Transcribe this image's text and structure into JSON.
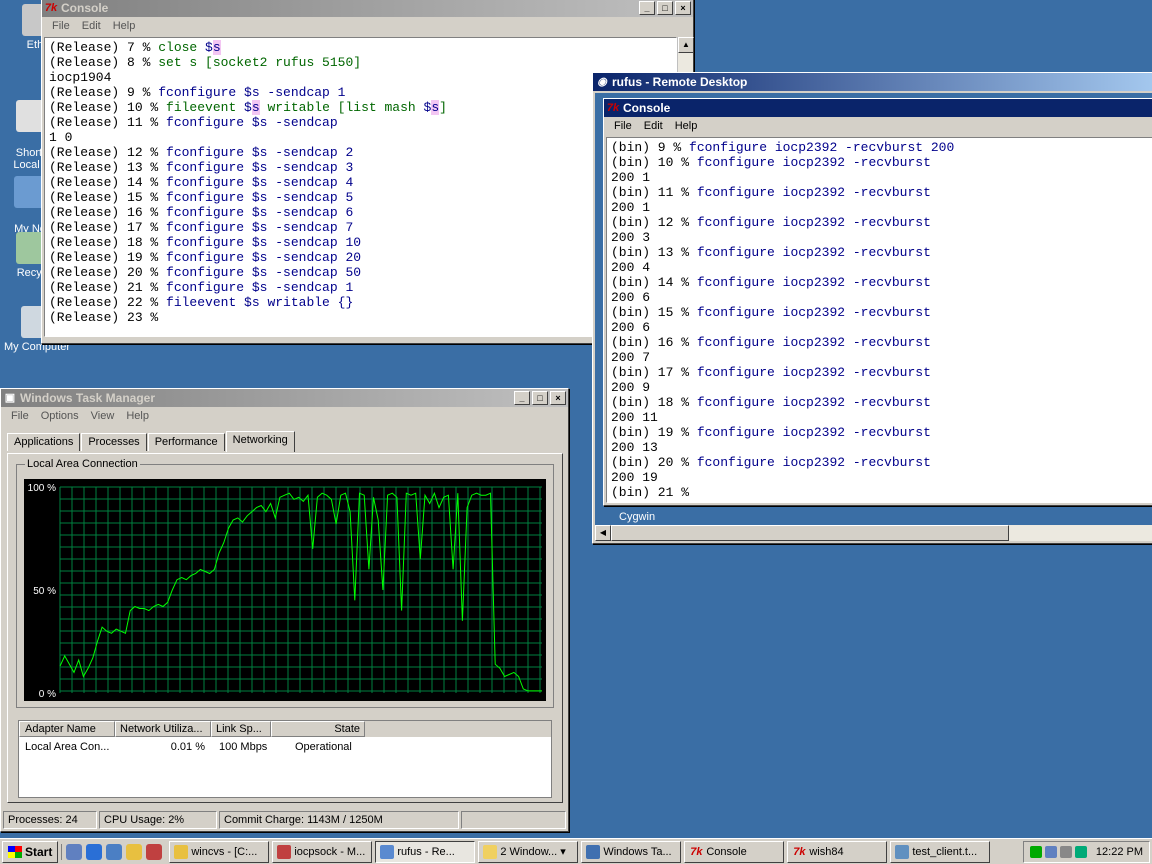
{
  "desktop": {
    "icons": [
      {
        "label": "Ethe",
        "top": 4
      },
      {
        "label": "Shorte\nLocal D",
        "top": 88
      },
      {
        "label": "My Ne\nPlac",
        "top": 164
      },
      {
        "label": "Recyc",
        "top": 236
      },
      {
        "label": "My Computer",
        "top": 310
      }
    ]
  },
  "console1": {
    "title": "Console",
    "menu": [
      "File",
      "Edit",
      "Help"
    ],
    "lines": [
      [
        [
          "(Release) 7 % ",
          ""
        ],
        [
          "close ",
          "cmd"
        ],
        [
          "$",
          "cmdb"
        ],
        [
          "s",
          "var cmdb"
        ]
      ],
      [
        [
          "(Release) 8 % ",
          ""
        ],
        [
          "set s [socket2 rufus 5150]",
          "cmd"
        ]
      ],
      [
        [
          "iocp1904",
          ""
        ]
      ],
      [
        [
          "(Release) 9 % ",
          ""
        ],
        [
          "fconfigure $s -sendcap 1",
          "cmdb"
        ]
      ],
      [
        [
          "(Release) 10 % ",
          ""
        ],
        [
          "fileevent ",
          "cmd"
        ],
        [
          "$",
          "cmdb"
        ],
        [
          "s",
          "var cmdb"
        ],
        [
          " writable [list mash ",
          "cmd"
        ],
        [
          "$",
          "cmdb"
        ],
        [
          "s",
          "var cmdb"
        ],
        [
          "]",
          "cmd"
        ]
      ],
      [
        [
          "(Release) 11 % ",
          ""
        ],
        [
          "fconfigure $s -sendcap",
          "cmdb"
        ]
      ],
      [
        [
          "1 0",
          ""
        ]
      ],
      [
        [
          "(Release) 12 % ",
          ""
        ],
        [
          "fconfigure $s -sendcap 2",
          "cmdb"
        ]
      ],
      [
        [
          "(Release) 13 % ",
          ""
        ],
        [
          "fconfigure $s -sendcap 3",
          "cmdb"
        ]
      ],
      [
        [
          "(Release) 14 % ",
          ""
        ],
        [
          "fconfigure $s -sendcap 4",
          "cmdb"
        ]
      ],
      [
        [
          "(Release) 15 % ",
          ""
        ],
        [
          "fconfigure $s -sendcap 5",
          "cmdb"
        ]
      ],
      [
        [
          "(Release) 16 % ",
          ""
        ],
        [
          "fconfigure $s -sendcap 6",
          "cmdb"
        ]
      ],
      [
        [
          "(Release) 17 % ",
          ""
        ],
        [
          "fconfigure $s -sendcap 7",
          "cmdb"
        ]
      ],
      [
        [
          "(Release) 18 % ",
          ""
        ],
        [
          "fconfigure $s -sendcap 10",
          "cmdb"
        ]
      ],
      [
        [
          "(Release) 19 % ",
          ""
        ],
        [
          "fconfigure $s -sendcap 20",
          "cmdb"
        ]
      ],
      [
        [
          "(Release) 20 % ",
          ""
        ],
        [
          "fconfigure $s -sendcap 50",
          "cmdb"
        ]
      ],
      [
        [
          "(Release) 21 % ",
          ""
        ],
        [
          "fconfigure $s -sendcap 1",
          "cmdb"
        ]
      ],
      [
        [
          "(Release) 22 % ",
          ""
        ],
        [
          "fileevent $s writable {}",
          "cmdb"
        ]
      ],
      [
        [
          "(Release) 23 % ",
          ""
        ]
      ]
    ]
  },
  "remote": {
    "title": "rufus - Remote Desktop",
    "inner_title": "Console",
    "menu": [
      "File",
      "Edit",
      "Help"
    ],
    "taskbar_label": "Cygwin",
    "lines": [
      [
        [
          "(bin) 9 % ",
          ""
        ],
        [
          "fconfigure iocp2392 -recvburst 200",
          "cmdb"
        ]
      ],
      [
        [
          "(bin) 10 % ",
          ""
        ],
        [
          "fconfigure iocp2392 -recvburst",
          "cmdb"
        ]
      ],
      [
        [
          "200 1",
          ""
        ]
      ],
      [
        [
          "(bin) 11 % ",
          ""
        ],
        [
          "fconfigure iocp2392 -recvburst",
          "cmdb"
        ]
      ],
      [
        [
          "200 1",
          ""
        ]
      ],
      [
        [
          "(bin) 12 % ",
          ""
        ],
        [
          "fconfigure iocp2392 -recvburst",
          "cmdb"
        ]
      ],
      [
        [
          "200 3",
          ""
        ]
      ],
      [
        [
          "(bin) 13 % ",
          ""
        ],
        [
          "fconfigure iocp2392 -recvburst",
          "cmdb"
        ]
      ],
      [
        [
          "200 4",
          ""
        ]
      ],
      [
        [
          "(bin) 14 % ",
          ""
        ],
        [
          "fconfigure iocp2392 -recvburst",
          "cmdb"
        ]
      ],
      [
        [
          "200 6",
          ""
        ]
      ],
      [
        [
          "(bin) 15 % ",
          ""
        ],
        [
          "fconfigure iocp2392 -recvburst",
          "cmdb"
        ]
      ],
      [
        [
          "200 6",
          ""
        ]
      ],
      [
        [
          "(bin) 16 % ",
          ""
        ],
        [
          "fconfigure iocp2392 -recvburst",
          "cmdb"
        ]
      ],
      [
        [
          "200 7",
          ""
        ]
      ],
      [
        [
          "(bin) 17 % ",
          ""
        ],
        [
          "fconfigure iocp2392 -recvburst",
          "cmdb"
        ]
      ],
      [
        [
          "200 9",
          ""
        ]
      ],
      [
        [
          "(bin) 18 % ",
          ""
        ],
        [
          "fconfigure iocp2392 -recvburst",
          "cmdb"
        ]
      ],
      [
        [
          "200 11",
          ""
        ]
      ],
      [
        [
          "(bin) 19 % ",
          ""
        ],
        [
          "fconfigure iocp2392 -recvburst",
          "cmdb"
        ]
      ],
      [
        [
          "200 13",
          ""
        ]
      ],
      [
        [
          "(bin) 20 % ",
          ""
        ],
        [
          "fconfigure iocp2392 -recvburst",
          "cmdb"
        ]
      ],
      [
        [
          "200 19",
          ""
        ]
      ],
      [
        [
          "(bin) 21 % ",
          ""
        ]
      ]
    ]
  },
  "taskmgr": {
    "title": "Windows Task Manager",
    "menu": [
      "File",
      "Options",
      "View",
      "Help"
    ],
    "tabs": [
      "Applications",
      "Processes",
      "Performance",
      "Networking"
    ],
    "selected_tab": "Networking",
    "group_label": "Local Area Connection",
    "y_labels": [
      "100 %",
      "50 %",
      "0 %"
    ],
    "columns": [
      "Adapter Name",
      "Network Utiliza...",
      "Link Sp...",
      "State"
    ],
    "rows": [
      [
        "Local Area Con...",
        "0.01 %",
        "100 Mbps",
        "Operational"
      ]
    ],
    "status": {
      "processes": "Processes: 24",
      "cpu": "CPU Usage: 2%",
      "commit": "Commit Charge: 1143M / 1250M"
    }
  },
  "chart_data": {
    "type": "line",
    "title": "",
    "xlabel": "",
    "ylabel": "",
    "ylim": [
      0,
      100
    ],
    "grid": true,
    "series": [
      {
        "values": [
          13,
          18,
          14,
          10,
          16,
          8,
          12,
          17,
          25,
          32,
          30,
          29,
          31,
          30,
          29,
          40,
          42,
          41,
          41,
          40,
          42,
          43,
          42,
          44,
          50,
          55,
          56,
          55,
          57,
          58,
          60,
          59,
          58,
          60,
          68,
          73,
          80,
          84,
          85,
          83,
          86,
          88,
          90,
          91,
          88,
          92,
          85,
          95,
          96,
          97,
          94,
          95,
          93,
          96,
          70,
          95,
          97,
          96,
          94,
          82,
          96,
          97,
          88,
          45,
          97,
          96,
          60,
          95,
          84,
          50,
          96,
          97,
          95,
          40,
          97,
          96,
          97,
          65,
          96,
          92,
          97,
          90,
          95,
          96,
          60,
          97,
          35,
          90,
          96,
          97,
          96,
          96,
          97,
          14,
          12,
          8,
          9,
          10,
          8,
          2,
          1,
          1,
          1,
          1
        ]
      }
    ]
  },
  "taskbar": {
    "start": "Start",
    "tasks": [
      "wincvs - [C:...",
      "iocpsock - M...",
      "rufus - Re...",
      "2 Window...",
      "Windows Ta...",
      "Console",
      "wish84",
      "test_client.t..."
    ],
    "active_task": 2,
    "clock": "12:22 PM"
  },
  "colors": {
    "desktop": "#3a6ea5",
    "graph_bg": "#000000",
    "graph_grid": "#008000",
    "graph_line": "#00ff00",
    "title_active": "#0a246a"
  }
}
